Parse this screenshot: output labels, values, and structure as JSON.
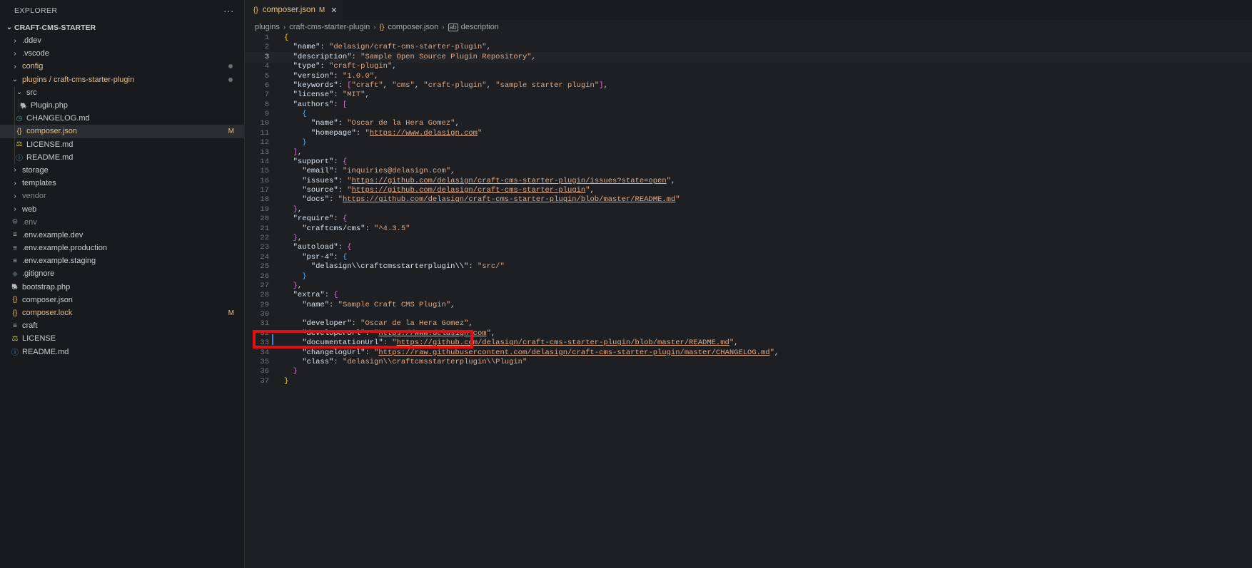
{
  "explorer": {
    "title": "EXPLORER",
    "more_label": "···",
    "root": "CRAFT-CMS-STARTER",
    "items": [
      {
        "label": ".ddev",
        "icon": "chevron-right",
        "indent": 0,
        "state": "",
        "mark": ""
      },
      {
        "label": ".vscode",
        "icon": "chevron-right",
        "indent": 0,
        "state": "",
        "mark": ""
      },
      {
        "label": "config",
        "icon": "chevron-right",
        "indent": 0,
        "state": "mod",
        "mark": "dot"
      },
      {
        "label": "plugins / craft-cms-starter-plugin",
        "icon": "chevron-down",
        "indent": 0,
        "state": "mod",
        "mark": "dot"
      },
      {
        "label": "src",
        "icon": "chevron-down",
        "indent": 1,
        "state": "",
        "mark": ""
      },
      {
        "label": "Plugin.php",
        "icon": "php",
        "indent": 2,
        "state": "",
        "mark": ""
      },
      {
        "label": "CHANGELOG.md",
        "icon": "changelog",
        "indent": 1,
        "state": "",
        "mark": ""
      },
      {
        "label": "composer.json",
        "icon": "json",
        "indent": 1,
        "state": "mod",
        "mark": "M",
        "selected": true
      },
      {
        "label": "LICENSE.md",
        "icon": "license",
        "indent": 1,
        "state": "",
        "mark": ""
      },
      {
        "label": "README.md",
        "icon": "info",
        "indent": 1,
        "state": "",
        "mark": ""
      },
      {
        "label": "storage",
        "icon": "chevron-right",
        "indent": 0,
        "state": "",
        "mark": ""
      },
      {
        "label": "templates",
        "icon": "chevron-right",
        "indent": 0,
        "state": "",
        "mark": ""
      },
      {
        "label": "vendor",
        "icon": "chevron-right",
        "indent": 0,
        "state": "dim",
        "mark": ""
      },
      {
        "label": "web",
        "icon": "chevron-right",
        "indent": 0,
        "state": "",
        "mark": ""
      },
      {
        "label": ".env",
        "icon": "gear",
        "indent": 0,
        "state": "dim",
        "mark": ""
      },
      {
        "label": ".env.example.dev",
        "icon": "lines",
        "indent": 0,
        "state": "",
        "mark": ""
      },
      {
        "label": ".env.example.production",
        "icon": "lines",
        "indent": 0,
        "state": "",
        "mark": ""
      },
      {
        "label": ".env.example.staging",
        "icon": "lines",
        "indent": 0,
        "state": "",
        "mark": ""
      },
      {
        "label": ".gitignore",
        "icon": "diamond",
        "indent": 0,
        "state": "",
        "mark": ""
      },
      {
        "label": "bootstrap.php",
        "icon": "php",
        "indent": 0,
        "state": "",
        "mark": ""
      },
      {
        "label": "composer.json",
        "icon": "json",
        "indent": 0,
        "state": "",
        "mark": ""
      },
      {
        "label": "composer.lock",
        "icon": "json",
        "indent": 0,
        "state": "mod",
        "mark": "M"
      },
      {
        "label": "craft",
        "icon": "lines",
        "indent": 0,
        "state": "",
        "mark": ""
      },
      {
        "label": "LICENSE",
        "icon": "license",
        "indent": 0,
        "state": "",
        "mark": ""
      },
      {
        "label": "README.md",
        "icon": "info",
        "indent": 0,
        "state": "",
        "mark": ""
      }
    ]
  },
  "tab": {
    "icon": "{}",
    "name": "composer.json",
    "modified": "M",
    "close": "✕"
  },
  "breadcrumb": [
    "plugins",
    "craft-cms-starter-plugin",
    "composer.json",
    "description"
  ],
  "editor": {
    "current_line": 3,
    "highlighted_line": 29,
    "lines": [
      [
        [
          "{",
          "b1"
        ]
      ],
      [
        [
          "  ",
          ""
        ],
        [
          "\"name\"",
          "k"
        ],
        [
          ": ",
          "p"
        ],
        [
          "\"delasign/craft-cms-starter-plugin\"",
          "s"
        ],
        [
          ",",
          "p"
        ]
      ],
      [
        [
          "  ",
          ""
        ],
        [
          "\"description\"",
          "k"
        ],
        [
          ": ",
          "p"
        ],
        [
          "\"Sample Open Source Plugin Repository\"",
          "s"
        ],
        [
          ",",
          "p"
        ]
      ],
      [
        [
          "  ",
          ""
        ],
        [
          "\"type\"",
          "k"
        ],
        [
          ": ",
          "p"
        ],
        [
          "\"craft-plugin\"",
          "s"
        ],
        [
          ",",
          "p"
        ]
      ],
      [
        [
          "  ",
          ""
        ],
        [
          "\"version\"",
          "k"
        ],
        [
          ": ",
          "p"
        ],
        [
          "\"1.0.0\"",
          "s"
        ],
        [
          ",",
          "p"
        ]
      ],
      [
        [
          "  ",
          ""
        ],
        [
          "\"keywords\"",
          "k"
        ],
        [
          ": ",
          "p"
        ],
        [
          "[",
          "b2"
        ],
        [
          "\"craft\"",
          "s"
        ],
        [
          ", ",
          "p"
        ],
        [
          "\"cms\"",
          "s"
        ],
        [
          ", ",
          "p"
        ],
        [
          "\"craft-plugin\"",
          "s"
        ],
        [
          ", ",
          "p"
        ],
        [
          "\"sample starter plugin\"",
          "s"
        ],
        [
          "]",
          "b2"
        ],
        [
          ",",
          "p"
        ]
      ],
      [
        [
          "  ",
          ""
        ],
        [
          "\"license\"",
          "k"
        ],
        [
          ": ",
          "p"
        ],
        [
          "\"MIT\"",
          "s"
        ],
        [
          ",",
          "p"
        ]
      ],
      [
        [
          "  ",
          ""
        ],
        [
          "\"authors\"",
          "k"
        ],
        [
          ": ",
          "p"
        ],
        [
          "[",
          "b2"
        ]
      ],
      [
        [
          "    ",
          ""
        ],
        [
          "{",
          "b3"
        ]
      ],
      [
        [
          "      ",
          ""
        ],
        [
          "\"name\"",
          "k"
        ],
        [
          ": ",
          "p"
        ],
        [
          "\"Oscar de la Hera Gomez\"",
          "s"
        ],
        [
          ",",
          "p"
        ]
      ],
      [
        [
          "      ",
          ""
        ],
        [
          "\"homepage\"",
          "k"
        ],
        [
          ": ",
          "p"
        ],
        [
          "\"",
          "s"
        ],
        [
          "https://www.delasign.com",
          "u"
        ],
        [
          "\"",
          "s"
        ]
      ],
      [
        [
          "    ",
          ""
        ],
        [
          "}",
          "b3"
        ]
      ],
      [
        [
          "  ",
          ""
        ],
        [
          "]",
          "b2"
        ],
        [
          ",",
          "p"
        ]
      ],
      [
        [
          "  ",
          ""
        ],
        [
          "\"support\"",
          "k"
        ],
        [
          ": ",
          "p"
        ],
        [
          "{",
          "b2"
        ]
      ],
      [
        [
          "    ",
          ""
        ],
        [
          "\"email\"",
          "k"
        ],
        [
          ": ",
          "p"
        ],
        [
          "\"inquiries@delasign.com\"",
          "s"
        ],
        [
          ",",
          "p"
        ]
      ],
      [
        [
          "    ",
          ""
        ],
        [
          "\"issues\"",
          "k"
        ],
        [
          ": ",
          "p"
        ],
        [
          "\"",
          "s"
        ],
        [
          "https://github.com/delasign/craft-cms-starter-plugin/issues?state=open",
          "u"
        ],
        [
          "\"",
          "s"
        ],
        [
          ",",
          "p"
        ]
      ],
      [
        [
          "    ",
          ""
        ],
        [
          "\"source\"",
          "k"
        ],
        [
          ": ",
          "p"
        ],
        [
          "\"",
          "s"
        ],
        [
          "https://github.com/delasign/craft-cms-starter-plugin",
          "u"
        ],
        [
          "\"",
          "s"
        ],
        [
          ",",
          "p"
        ]
      ],
      [
        [
          "    ",
          ""
        ],
        [
          "\"docs\"",
          "k"
        ],
        [
          ": ",
          "p"
        ],
        [
          "\"",
          "s"
        ],
        [
          "https://github.com/delasign/craft-cms-starter-plugin/blob/master/README.md",
          "u"
        ],
        [
          "\"",
          "s"
        ]
      ],
      [
        [
          "  ",
          ""
        ],
        [
          "}",
          "b2"
        ],
        [
          ",",
          "p"
        ]
      ],
      [
        [
          "  ",
          ""
        ],
        [
          "\"require\"",
          "k"
        ],
        [
          ": ",
          "p"
        ],
        [
          "{",
          "b2"
        ]
      ],
      [
        [
          "    ",
          ""
        ],
        [
          "\"craftcms/cms\"",
          "k"
        ],
        [
          ": ",
          "p"
        ],
        [
          "\"^4.3.5\"",
          "s"
        ]
      ],
      [
        [
          "  ",
          ""
        ],
        [
          "}",
          "b2"
        ],
        [
          ",",
          "p"
        ]
      ],
      [
        [
          "  ",
          ""
        ],
        [
          "\"autoload\"",
          "k"
        ],
        [
          ": ",
          "p"
        ],
        [
          "{",
          "b2"
        ]
      ],
      [
        [
          "    ",
          ""
        ],
        [
          "\"psr-4\"",
          "k"
        ],
        [
          ": ",
          "p"
        ],
        [
          "{",
          "b3"
        ]
      ],
      [
        [
          "      ",
          ""
        ],
        [
          "\"delasign\\\\craftcmsstarterplugin\\\\\"",
          "k"
        ],
        [
          ": ",
          "p"
        ],
        [
          "\"src/\"",
          "s"
        ]
      ],
      [
        [
          "    ",
          ""
        ],
        [
          "}",
          "b3"
        ]
      ],
      [
        [
          "  ",
          ""
        ],
        [
          "}",
          "b2"
        ],
        [
          ",",
          "p"
        ]
      ],
      [
        [
          "  ",
          ""
        ],
        [
          "\"extra\"",
          "k"
        ],
        [
          ": ",
          "p"
        ],
        [
          "{",
          "b2"
        ]
      ],
      [
        [
          "    ",
          ""
        ],
        [
          "\"name\"",
          "k"
        ],
        [
          ": ",
          "p"
        ],
        [
          "\"Sample Craft CMS Plugin\"",
          "s"
        ],
        [
          ",",
          "p"
        ]
      ],
      [
        [
          "",
          ""
        ]
      ],
      [
        [
          "    ",
          ""
        ],
        [
          "\"developer\"",
          "k"
        ],
        [
          ": ",
          "p"
        ],
        [
          "\"Oscar de la Hera Gomez\"",
          "s"
        ],
        [
          ",",
          "p"
        ]
      ],
      [
        [
          "    ",
          ""
        ],
        [
          "\"developerUrl\"",
          "k"
        ],
        [
          ": ",
          "p"
        ],
        [
          "\"",
          "s"
        ],
        [
          "https://www.delasign.com",
          "u"
        ],
        [
          "\"",
          "s"
        ],
        [
          ",",
          "p"
        ]
      ],
      [
        [
          "    ",
          ""
        ],
        [
          "\"documentationUrl\"",
          "k"
        ],
        [
          ": ",
          "p"
        ],
        [
          "\"",
          "s"
        ],
        [
          "https://github.com/delasign/craft-cms-starter-plugin/blob/master/README.md",
          "u"
        ],
        [
          "\"",
          "s"
        ],
        [
          ",",
          "p"
        ]
      ],
      [
        [
          "    ",
          ""
        ],
        [
          "\"changelogUrl\"",
          "k"
        ],
        [
          ": ",
          "p"
        ],
        [
          "\"",
          "s"
        ],
        [
          "https://raw.githubusercontent.com/delasign/craft-cms-starter-plugin/master/CHANGELOG.md",
          "u"
        ],
        [
          "\"",
          "s"
        ],
        [
          ",",
          "p"
        ]
      ],
      [
        [
          "    ",
          ""
        ],
        [
          "\"class\"",
          "k"
        ],
        [
          ": ",
          "p"
        ],
        [
          "\"delasign\\\\craftcmsstarterplugin\\\\Plugin\"",
          "s"
        ]
      ],
      [
        [
          "  ",
          ""
        ],
        [
          "}",
          "b2"
        ]
      ],
      [
        [
          "}",
          "b1"
        ]
      ]
    ]
  },
  "colors": {
    "accent": "#e2c08d",
    "highlight_box": "#e00f14",
    "background": "#1e1f22"
  }
}
